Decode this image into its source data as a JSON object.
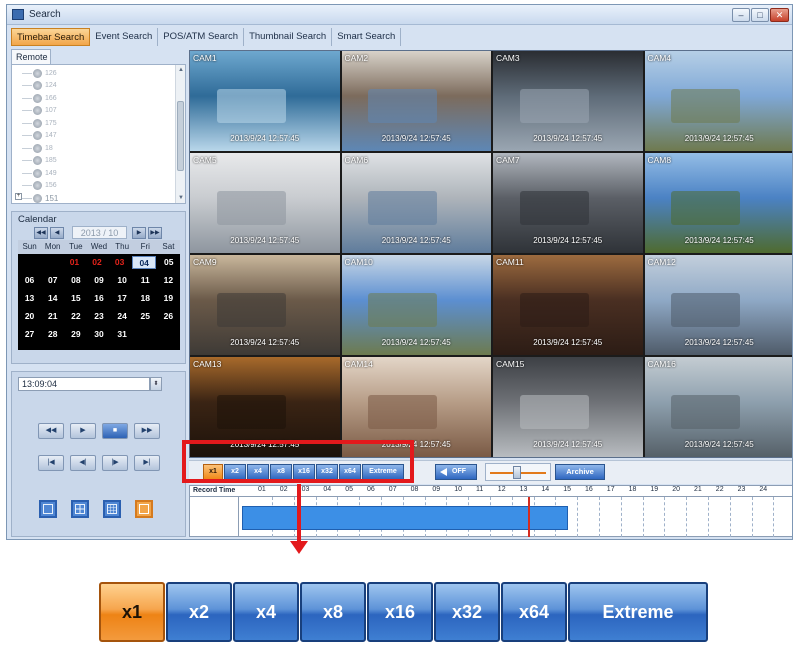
{
  "window": {
    "title": "Search"
  },
  "tabs": [
    "Timebar Search",
    "Event Search",
    "POS/ATM Search",
    "Thumbnail Search",
    "Smart Search"
  ],
  "left": {
    "remote_tab": "Remote",
    "tree_items": [
      "126",
      "124",
      "166",
      "107",
      "175",
      "147",
      "18",
      "185",
      "149",
      "156",
      "151"
    ],
    "calendar": {
      "title": "Calendar",
      "month": "2013 / 10",
      "weekdays": [
        "Sun",
        "Mon",
        "Tue",
        "Wed",
        "Thu",
        "Fri",
        "Sat"
      ],
      "weeks": [
        [
          "",
          "",
          "01",
          "02",
          "03",
          "04",
          "05"
        ],
        [
          "06",
          "07",
          "08",
          "09",
          "10",
          "11",
          "12"
        ],
        [
          "13",
          "14",
          "15",
          "16",
          "17",
          "18",
          "19"
        ],
        [
          "20",
          "21",
          "22",
          "23",
          "24",
          "25",
          "26"
        ],
        [
          "27",
          "28",
          "29",
          "30",
          "31",
          "",
          ""
        ]
      ],
      "recorded": [
        "01",
        "02",
        "03"
      ],
      "selected": "04"
    },
    "time": "13:09:04"
  },
  "cameras": [
    {
      "name": "CAM1",
      "ts": "2013/9/24 12:57:45",
      "colors": [
        "#2f6b98",
        "#6ea8cf",
        "#b9d7ea"
      ]
    },
    {
      "name": "CAM2",
      "ts": "2013/9/24 12:57:45",
      "colors": [
        "#7c6b5c",
        "#d8d2c9",
        "#5e87b5"
      ]
    },
    {
      "name": "CAM3",
      "ts": "2013/9/24 12:57:45",
      "colors": [
        "#5e6b78",
        "#2a2d32",
        "#9aa6b2"
      ]
    },
    {
      "name": "CAM4",
      "ts": "2013/9/24 12:57:45",
      "colors": [
        "#7fa8d6",
        "#b6cfe6",
        "#6f7a4f"
      ]
    },
    {
      "name": "CAM5",
      "ts": "2013/9/24 12:57:45",
      "colors": [
        "#c9ccd0",
        "#e8e9eb",
        "#8e969f"
      ]
    },
    {
      "name": "CAM6",
      "ts": "2013/9/24 12:57:45",
      "colors": [
        "#aeb4ba",
        "#dfe2e5",
        "#5f7c9c"
      ]
    },
    {
      "name": "CAM7",
      "ts": "2013/9/24 12:57:45",
      "colors": [
        "#5b5f66",
        "#b1b7bf",
        "#2f3338"
      ]
    },
    {
      "name": "CAM8",
      "ts": "2013/9/24 12:57:45",
      "colors": [
        "#4b82c4",
        "#94bde6",
        "#4f6b2f"
      ]
    },
    {
      "name": "CAM9",
      "ts": "2013/9/24 12:57:45",
      "colors": [
        "#6b5a49",
        "#c9b79c",
        "#3e3a36"
      ]
    },
    {
      "name": "CAM10",
      "ts": "2013/9/24 12:57:45",
      "colors": [
        "#5c8fd1",
        "#c8d7e6",
        "#6d7b4f"
      ]
    },
    {
      "name": "CAM11",
      "ts": "2013/9/24 12:57:45",
      "colors": [
        "#4a2f22",
        "#9d6b3f",
        "#2c1c15"
      ]
    },
    {
      "name": "CAM12",
      "ts": "2013/9/24 12:57:45",
      "colors": [
        "#8fa9c6",
        "#c3cfdc",
        "#4f5b69"
      ]
    },
    {
      "name": "CAM13",
      "ts": "2013/9/24 12:57:45",
      "colors": [
        "#3a2414",
        "#a86a2b",
        "#1d120a"
      ]
    },
    {
      "name": "CAM14",
      "ts": "2013/9/24 12:57:45",
      "colors": [
        "#b79d87",
        "#e3d6c8",
        "#7a5a45"
      ]
    },
    {
      "name": "CAM15",
      "ts": "2013/9/24 12:57:45",
      "colors": [
        "#6e7176",
        "#3d4045",
        "#b8bcc0"
      ]
    },
    {
      "name": "CAM16",
      "ts": "2013/9/24 12:57:45",
      "colors": [
        "#8ea0ae",
        "#c4ccd2",
        "#556068"
      ]
    }
  ],
  "playbar": {
    "speeds": [
      "x1",
      "x2",
      "x4",
      "x8",
      "x16",
      "x32",
      "x64",
      "Extreme"
    ],
    "active_speed": "x1",
    "audio_label": "OFF",
    "archive_label": "Archive"
  },
  "timeline": {
    "label": "Record Time",
    "hours": [
      "01",
      "02",
      "03",
      "04",
      "05",
      "06",
      "07",
      "08",
      "09",
      "10",
      "11",
      "12",
      "13",
      "14",
      "15",
      "16",
      "17",
      "18",
      "19",
      "20",
      "21",
      "22",
      "23",
      "24"
    ]
  },
  "zoom": {
    "speeds": [
      "x1",
      "x2",
      "x4",
      "x8",
      "x16",
      "x32",
      "x64",
      "Extreme"
    ]
  }
}
